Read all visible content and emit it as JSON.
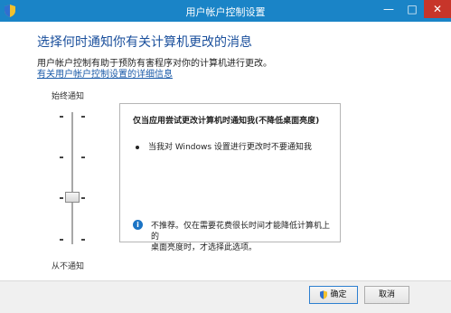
{
  "window": {
    "title": "用户帐户控制设置",
    "controls": {
      "minimize": "—",
      "maximize": "□",
      "close": "✕"
    }
  },
  "main": {
    "heading": "选择何时通知你有关计算机更改的消息",
    "description": "用户帐户控制有助于预防有害程序对你的计算机进行更改。",
    "link": "有关用户帐户控制设置的详细信息"
  },
  "slider": {
    "top_label": "始终通知",
    "bottom_label": "从不通知",
    "levels": 4,
    "selected_level": 2
  },
  "panel": {
    "title": "仅当应用尝试更改计算机时通知我(不降低桌面亮度)",
    "bullet": "当我对 Windows 设置进行更改时不要通知我",
    "note_line1": "不推荐。仅在需要花费很长时间才能降低计算机上的",
    "note_line2": "桌面亮度时，才选择此选项。"
  },
  "buttons": {
    "ok": "确定",
    "cancel": "取消"
  },
  "colors": {
    "titlebar": "#1a84c7",
    "heading": "#1a4f9c",
    "close": "#c7352a"
  }
}
